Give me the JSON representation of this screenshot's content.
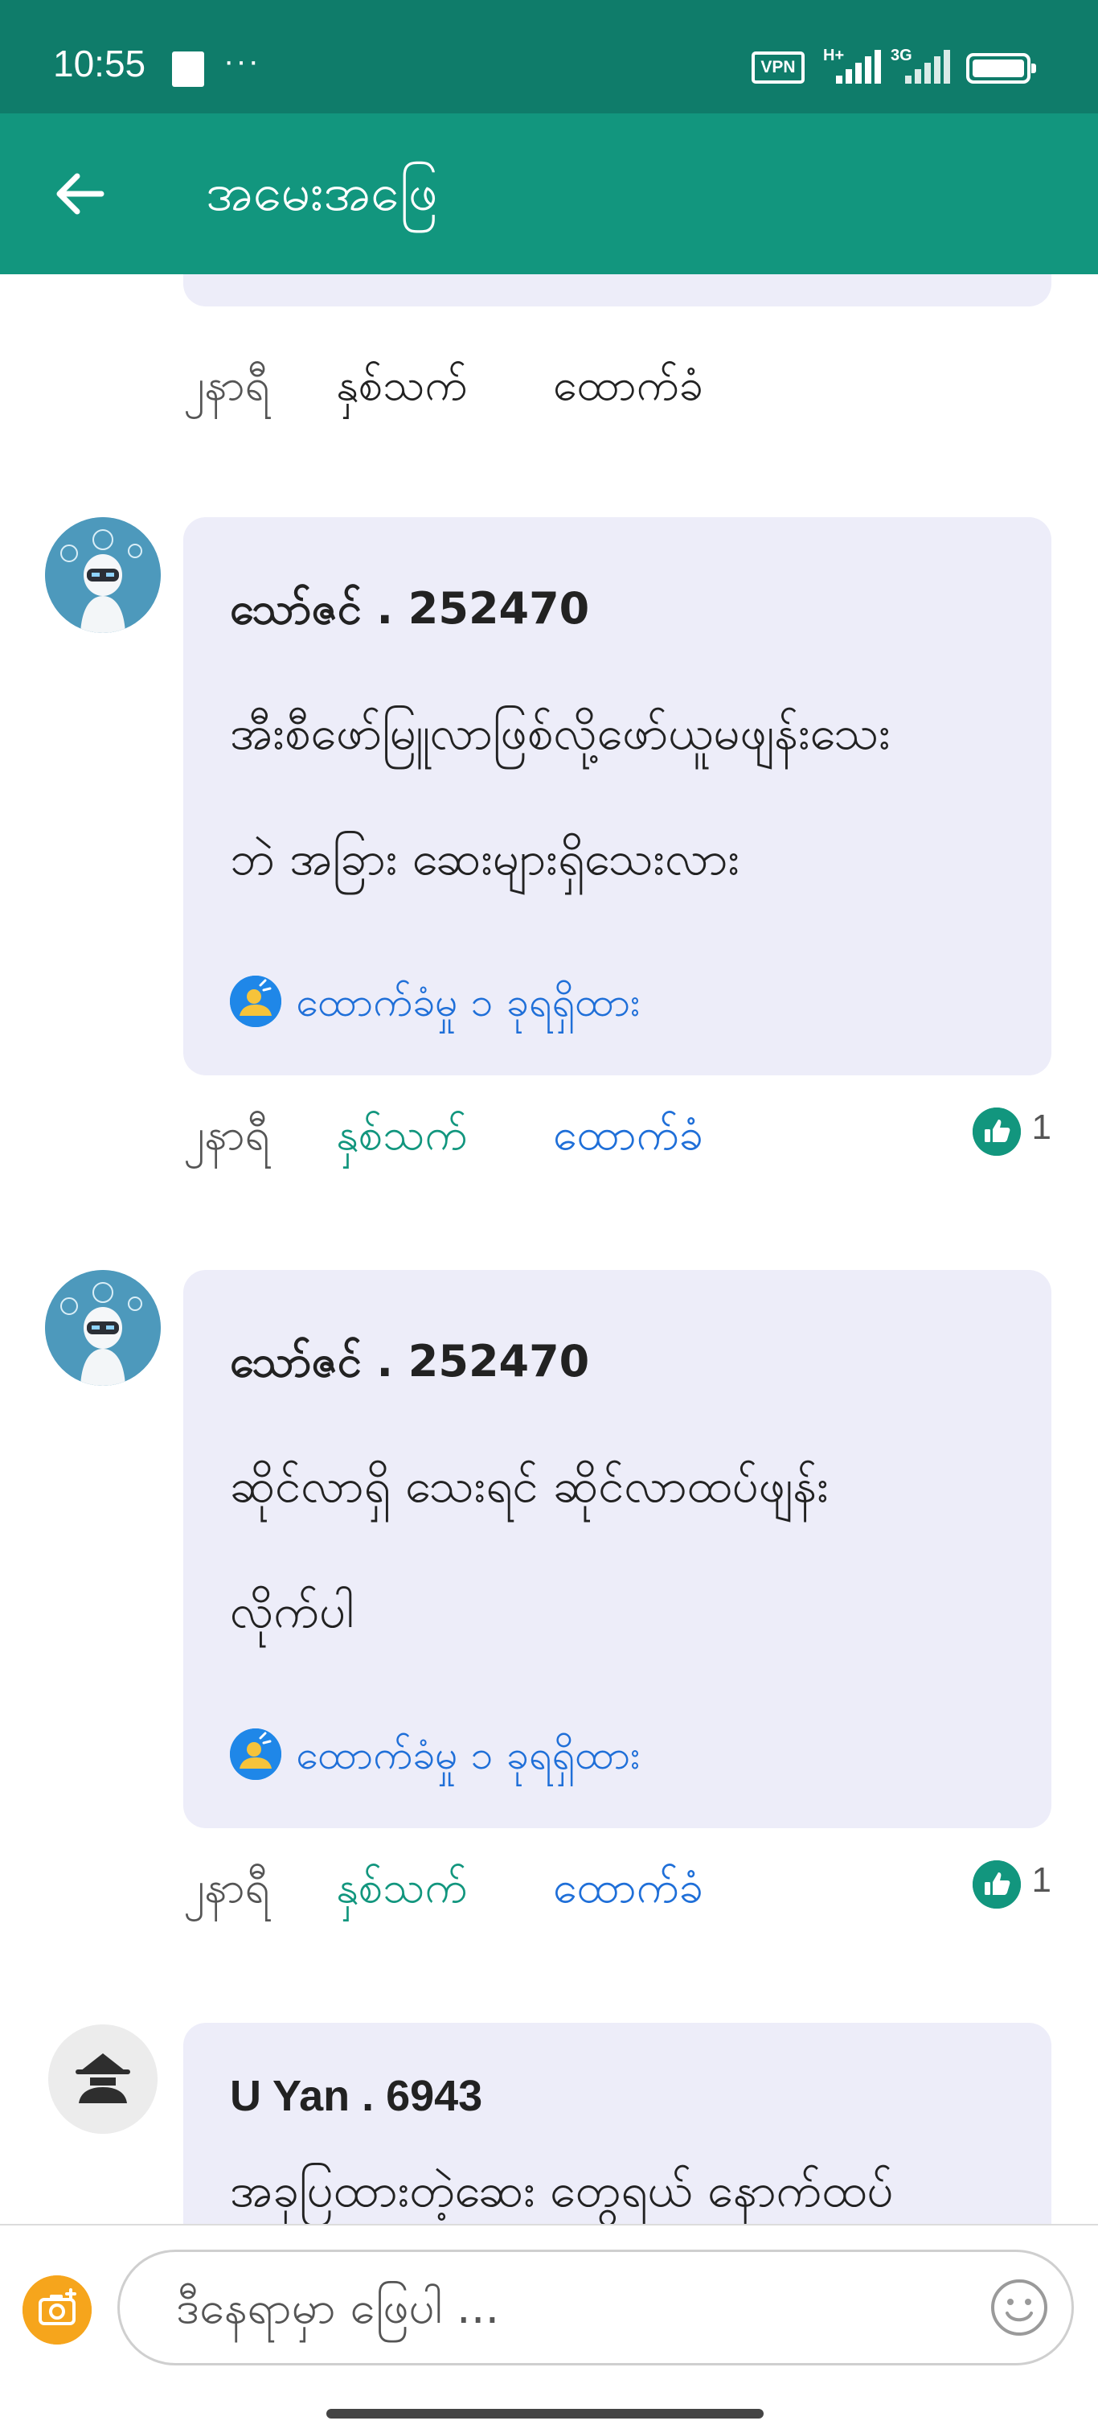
{
  "status_bar": {
    "time": "10:55",
    "more": "···",
    "vpn": "VPN",
    "net1": "H+",
    "net2": "3G",
    "icons": [
      "notification-square-icon",
      "vpn-icon",
      "signal-icon",
      "signal-icon",
      "battery-icon"
    ]
  },
  "app_bar": {
    "title": "အမေးအဖြေ",
    "back_icon": "arrow-left-icon"
  },
  "top_partial": {
    "time": "၂နာရီ",
    "like_label": "နှစ်သက်",
    "reply_label": "ထောက်ခံ"
  },
  "comments": [
    {
      "author": "သော်ဇင် . 252470",
      "avatar": "robot-avatar",
      "lines": [
        "အီးစီဖော်မြူလာဖြစ်လို့ဖော်ယူမဖျန်းသေး",
        "ဘဲ အခြား ဆေးများရှိသေးလား"
      ],
      "replies": "ထောက်ခံမှု ၁ ခုရရှိထား",
      "time": "၂နာရီ",
      "like_label": "နှစ်သက်",
      "reply_label": "ထောက်ခံ",
      "likes": "1"
    },
    {
      "author": "သော်ဇင် . 252470",
      "avatar": "robot-avatar",
      "lines": [
        "ဆိုင်လာရှိ သေးရင် ဆိုင်လာထပ်ဖျန်း",
        "လိုက်ပါ"
      ],
      "replies": "ထောက်ခံမှု ၁ ခုရရှိထား",
      "time": "၂နာရီ",
      "like_label": "နှစ်သက်",
      "reply_label": "ထောက်ခံ",
      "likes": "1"
    },
    {
      "author": "U Yan . 6943",
      "avatar": "anonymous-avatar",
      "lines": [
        "အခုပြထားတဲ့ဆေး တွေရယ် နောက်ထပ်"
      ]
    }
  ],
  "input_bar": {
    "placeholder": "ဒီနေရာမှာ ဖြေပါ ...",
    "camera_icon": "camera-icon",
    "emoji_icon": "emoji-icon"
  },
  "colors": {
    "status_bar": "#0f7c6a",
    "app_bar": "#12967e",
    "like_active": "#12967e",
    "reply_active": "#1f6fd8",
    "card_bg": "#ededf9",
    "camera": "#f6a51c"
  }
}
